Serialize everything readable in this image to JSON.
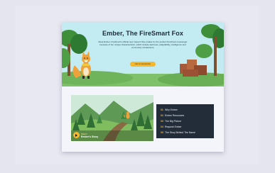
{
  "hero": {
    "title": "Ember, The FireSmart Fox",
    "description": "Meet Ember, FireSmart's official new mascot! She makes for the perfect FireSmart messenger because of her unique characteristics, which include alertness, adaptability, intelligence and community mindedness.",
    "button_label": "Get to know Ember"
  },
  "video": {
    "kicker": "Watch",
    "title": "Ember's Story"
  },
  "menu": {
    "items": [
      {
        "num": "01",
        "label": "Why Ember"
      },
      {
        "num": "02",
        "label": "Ember Resources"
      },
      {
        "num": "03",
        "label": "The Big Picture"
      },
      {
        "num": "04",
        "label": "Request Ember"
      },
      {
        "num": "05",
        "label": "The Story Behind The Name"
      }
    ]
  },
  "colors": {
    "hero_bg": "#c3ecf2",
    "accent": "#f5b72c",
    "menu_bg": "#232d3a",
    "tree_green": "#3f8f3a"
  }
}
